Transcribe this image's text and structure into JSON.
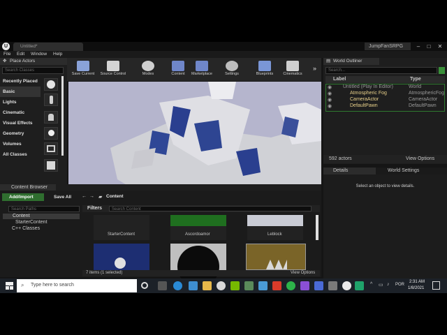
{
  "app": {
    "tab_title": "Untitled*",
    "project_name": "JumpFanSRPG",
    "menu": [
      "File",
      "Edit",
      "Window",
      "Help"
    ]
  },
  "place_actors": {
    "tab": "Place Actors",
    "search_placeholder": "Search Classes",
    "categories": [
      "Recently Placed",
      "Basic",
      "Lights",
      "Cinematic",
      "Visual Effects",
      "Geometry",
      "Volumes",
      "All Classes"
    ]
  },
  "toolbar": {
    "buttons": [
      "Save Current",
      "Source Control",
      "Modes",
      "Content",
      "Marketplace",
      "Settings",
      "Blueprints",
      "Cinematics"
    ]
  },
  "outliner": {
    "tab": "World Outliner",
    "search_placeholder": "Search...",
    "col_label": "Label",
    "col_type": "Type",
    "rows": [
      {
        "label": "Untitled (Play In Editor)",
        "type": "World"
      },
      {
        "label": "Atmospheric Fog",
        "type": "AtmosphericFog"
      },
      {
        "label": "CameraActor",
        "type": "CameraActor"
      },
      {
        "label": "DefaultPawn",
        "type": "DefaultPawn"
      }
    ],
    "actor_count": "592 actors",
    "view_options": "View Options"
  },
  "details": {
    "tab": "Details",
    "tab2": "World Settings",
    "empty_msg": "Select an object to view details."
  },
  "content_browser": {
    "tab": "Content Browser",
    "add_import": "Add/Import",
    "save_all": "Save All",
    "path": "Content",
    "search_paths": "Search Paths",
    "filters": "Filters",
    "search_content": "Search Content",
    "tree": [
      "Content",
      "StarterContent",
      "C++ Classes"
    ],
    "assets": [
      "StarterContent",
      "Ascordoamor",
      "Leblock"
    ],
    "status": "7 items (1 selected)",
    "view_options": "View Options"
  },
  "taskbar": {
    "search_placeholder": "Type here to search",
    "lang": "POR",
    "time": "2:31 AM",
    "date": "1/8/2021"
  }
}
